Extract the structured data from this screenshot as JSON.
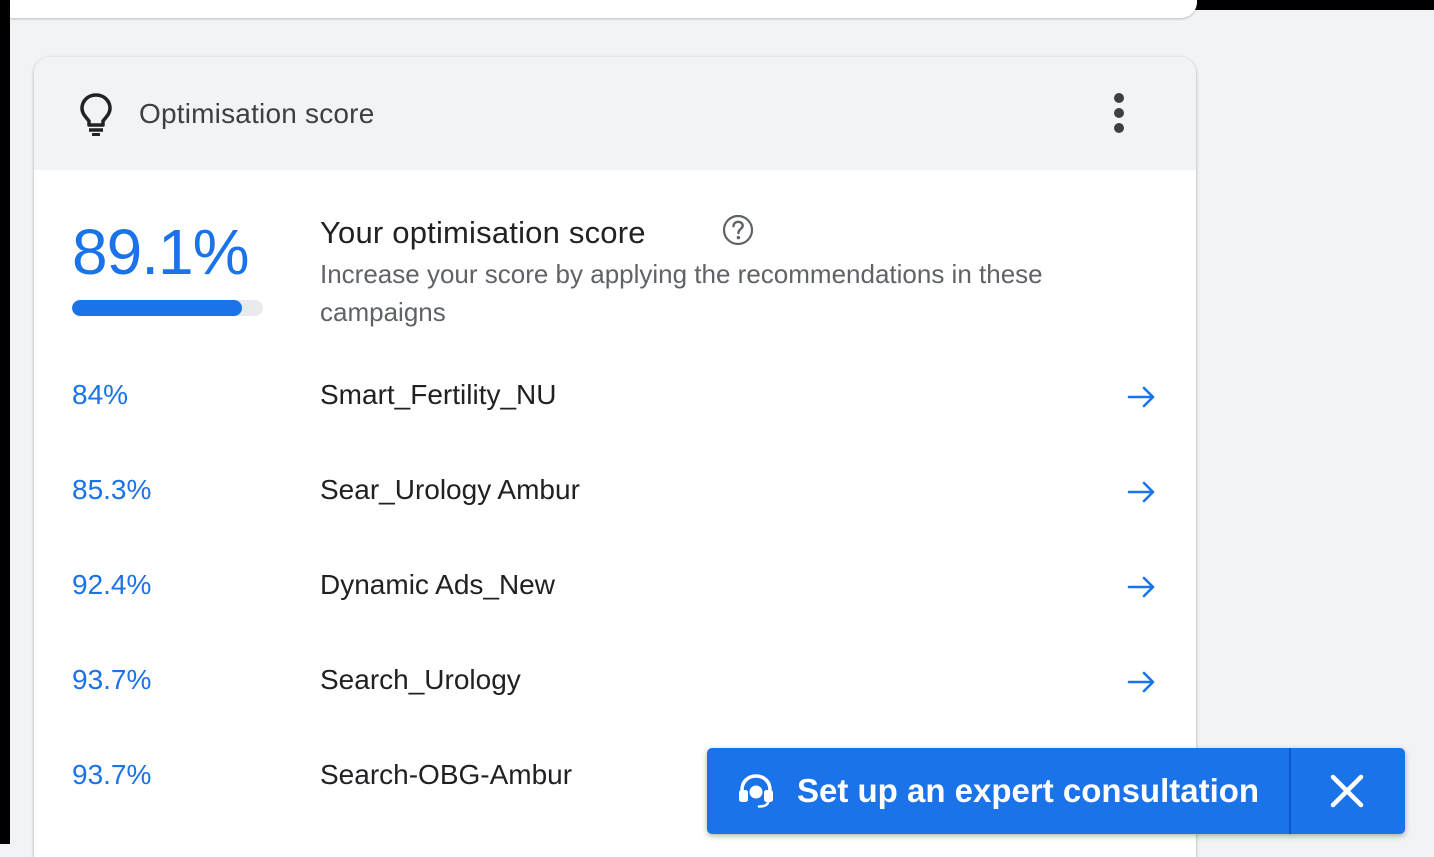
{
  "colors": {
    "accent": "#1a73e8",
    "header_bg": "#f1f3f4",
    "text_primary": "#202124",
    "text_secondary": "#5f6368"
  },
  "card": {
    "title": "Optimisation score",
    "title_icon": "lightbulb-icon",
    "menu_icon": "more-vert-icon"
  },
  "summary": {
    "score": "89.1%",
    "progress": 0.891,
    "heading": "Your optimisation score",
    "help_icon": "help-circle-icon",
    "description": "Increase your score by applying the recommendations in these campaigns"
  },
  "campaigns": [
    {
      "score": "84%",
      "name": "Smart_Fertility_NU",
      "icon": "arrow-right-icon"
    },
    {
      "score": "85.3%",
      "name": "Sear_Urology Ambur",
      "icon": "arrow-right-icon"
    },
    {
      "score": "92.4%",
      "name": "Dynamic Ads_New",
      "icon": "arrow-right-icon"
    },
    {
      "score": "93.7%",
      "name": "Search_Urology",
      "icon": "arrow-right-icon"
    },
    {
      "score": "93.7%",
      "name": "Search-OBG-Ambur",
      "icon": ""
    }
  ],
  "consultation_bar": {
    "label": "Set up an expert consultation",
    "icon": "headset-icon",
    "close_icon": "close-icon"
  }
}
